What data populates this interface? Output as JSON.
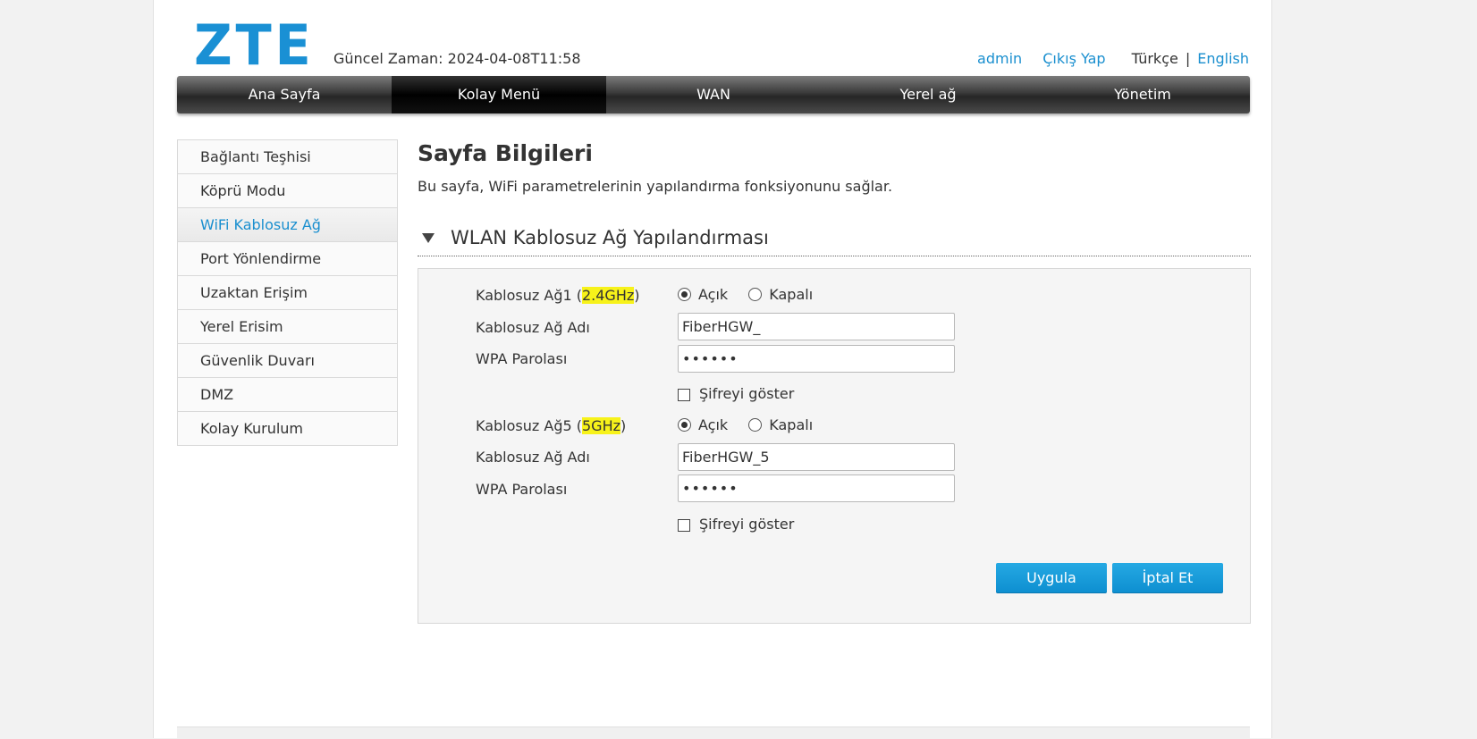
{
  "header": {
    "logo": "ZTE",
    "time_label": "Güncel Zaman: 2024-04-08T11:58",
    "user": "admin",
    "logout": "Çıkış Yap",
    "lang_current": "Türkçe",
    "lang_sep": "|",
    "lang_other": "English"
  },
  "nav": {
    "items": [
      "Ana Sayfa",
      "Kolay Menü",
      "WAN",
      "Yerel ağ",
      "Yönetim"
    ],
    "active": "Kolay Menü"
  },
  "sidebar": {
    "items": [
      "Bağlantı Teşhisi",
      "Köprü Modu",
      "WiFi Kablosuz Ağ",
      "Port Yönlendirme",
      "Uzaktan Erişim",
      "Yerel Erisim",
      "Güvenlik Duvarı",
      "DMZ",
      "Kolay Kurulum"
    ],
    "active": "WiFi Kablosuz Ağ"
  },
  "content": {
    "title": "Sayfa Bilgileri",
    "description": "Bu sayfa, WiFi parametrelerinin yapılandırma fonksiyonunu sağlar.",
    "section_title": "WLAN Kablosuz Ağ Yapılandırması"
  },
  "wlan1": {
    "label_prefix": "Kablosuz Ağ1 (",
    "label_band": "2.4GHz",
    "label_suffix": ")",
    "on_label": "Açık",
    "off_label": "Kapalı",
    "state": "on",
    "ssid_label": "Kablosuz Ağ Adı",
    "ssid_value": "FiberHGW_",
    "pwd_label": "WPA Parolası",
    "pwd_value": "••••••",
    "show_pwd_label": "Şifreyi göster"
  },
  "wlan5": {
    "label_prefix": "Kablosuz Ağ5 (",
    "label_band": "5GHz",
    "label_suffix": ")",
    "on_label": "Açık",
    "off_label": "Kapalı",
    "state": "on",
    "ssid_label": "Kablosuz Ağ Adı",
    "ssid_value": "FiberHGW_5",
    "pwd_label": "WPA Parolası",
    "pwd_value": "••••••",
    "show_pwd_label": "Şifreyi göster"
  },
  "buttons": {
    "apply": "Uygula",
    "cancel": "İptal Et"
  },
  "colors": {
    "accent": "#1a8fcf",
    "button": "#0d8ed0",
    "highlight": "#f7f21a"
  }
}
